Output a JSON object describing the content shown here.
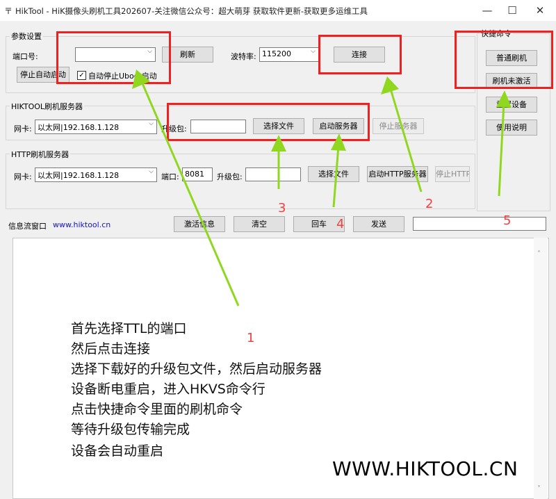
{
  "window": {
    "title": "HikTool - HiK摄像头刷机工具202607-关注微信公众号：超大萌芽 获取软件更新-获取更多运维工具",
    "controls": {
      "minimize": "—",
      "maximize": "☐",
      "close": "✕"
    }
  },
  "params": {
    "group_label": "参数设置",
    "port_label": "端口号:",
    "port_value": "",
    "refresh_label": "刷新",
    "baud_label": "波特率:",
    "baud_value": "115200",
    "connect_label": "连接",
    "stop_autostart_label": "停止自动启动",
    "auto_stop_uboot_label": "自动停止Uboot启动",
    "auto_stop_uboot_checked": true
  },
  "quick": {
    "group_label": "快捷命令",
    "normal_flash_label": "普通刷机",
    "flash_unactivated_label": "刷机未激活",
    "reset_device_label": "重置设备",
    "usage_label": "使用说明"
  },
  "hiktool_server": {
    "group_label": "HIKTOOL刷机服务器",
    "nic_label": "网卡:",
    "nic_value": "以太网|192.168.1.128",
    "upgrade_label": "升级包:",
    "upgrade_value": "",
    "choose_file_label": "选择文件",
    "start_server_label": "启动服务器",
    "stop_server_label": "停止服务器"
  },
  "http_server": {
    "group_label": "HTTP刷机服务器",
    "nic_label": "网卡:",
    "nic_value": "以太网|192.168.1.128",
    "port_label": "端口:",
    "port_value": "8081",
    "upgrade_label": "升级包:",
    "upgrade_value": "",
    "choose_file_label": "选择文件",
    "start_server_label": "启动HTTP服务器",
    "stop_server_label": "停止HTTP"
  },
  "log": {
    "label": "信息流窗口",
    "site": "www.hiktool.cn",
    "activate_info_label": "激活信息",
    "clear_label": "清空",
    "enter_label": "回车",
    "send_label": "发送",
    "send_value": ""
  },
  "annotations": {
    "steps": [
      "首先选择TTL的端口",
      "然后点击连接",
      "选择下载好的升级包文件，然后启动服务器",
      "设备断电重启，进入HKVS命令行",
      "点击快捷命令里面的刷机命令",
      "等待升级包传输完成",
      "设备会自动重启"
    ],
    "numbers": [
      "1",
      "2",
      "3",
      "4",
      "5"
    ],
    "watermark": "WWW.HIKTOOL.CN",
    "marker_color": "#f02020",
    "arrow_color": "#8fd81f"
  }
}
